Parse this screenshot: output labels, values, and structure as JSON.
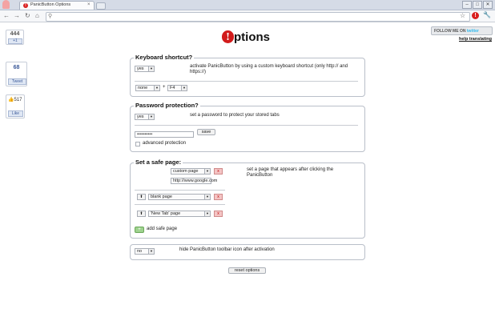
{
  "browser": {
    "tab_title": "PanicButton Options",
    "tab_close": "×",
    "favicon_glyph": "!",
    "win_min": "–",
    "win_max": "□",
    "win_close": "✕"
  },
  "social": {
    "plusone_count": "444",
    "plusone_label": "+1",
    "tweet_count": "68",
    "tweet_label": "Tweet",
    "like_count": "517",
    "like_label": "Like"
  },
  "header": {
    "logo_letter": "!",
    "title": "ptions",
    "follow_label": "FOLLOW ME ON",
    "twitter_label": "twitter",
    "help_translating": "help translating"
  },
  "keyboard": {
    "title": "Keyboard shortcut?",
    "enable_value": "yes",
    "description": "activate PanicButton by using a custom keyboard shortcut (only http:// and https://)",
    "modifier_value": "none",
    "plus": "+",
    "key_value": "F4"
  },
  "password": {
    "title": "Password protection?",
    "enable_value": "yes",
    "description": "set a password to protect your stored tabs",
    "password_value": "••••••••••",
    "save_label": "save",
    "advanced_label": "advanced protection"
  },
  "safe_page": {
    "title": "Set a safe page:",
    "description": "set a page that appears after clicking the PanicButton",
    "pages": [
      {
        "value": "custom page",
        "url": "http://www.google.com"
      },
      {
        "value": "blank page"
      },
      {
        "value": "'New Tab' page"
      }
    ],
    "add_label": "add safe page",
    "remove_glyph": "x",
    "up_glyph": "⬆",
    "add_glyph": "+"
  },
  "hide_icon": {
    "value": "no",
    "description": "hide PanicButton toolbar icon after activation"
  },
  "reset_label": "reset options",
  "colors": {
    "brand_red": "#d21b1b",
    "twitter_blue": "#33bbee",
    "facebook_blue": "#3b5998"
  }
}
